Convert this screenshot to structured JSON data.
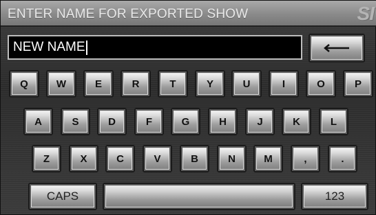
{
  "header": {
    "title": "ENTER NAME FOR EXPORTED SHOW",
    "logo_text": "SI"
  },
  "input": {
    "value": "NEW NAME"
  },
  "keyboard": {
    "row1": [
      "Q",
      "W",
      "E",
      "R",
      "T",
      "Y",
      "U",
      "I",
      "O",
      "P"
    ],
    "row2": [
      "A",
      "S",
      "D",
      "F",
      "G",
      "H",
      "J",
      "K",
      "L"
    ],
    "row3": [
      "Z",
      "X",
      "C",
      "V",
      "B",
      "N",
      "M",
      ",",
      "."
    ],
    "caps_label": "CAPS",
    "space_label": "",
    "numeric_label": "123",
    "backspace_icon": "left-arrow-icon"
  },
  "colors": {
    "header_bg": "#8a8a8a",
    "screen_bg": "#333333",
    "input_bg": "#000000",
    "key_face": "#c8c8c8"
  }
}
